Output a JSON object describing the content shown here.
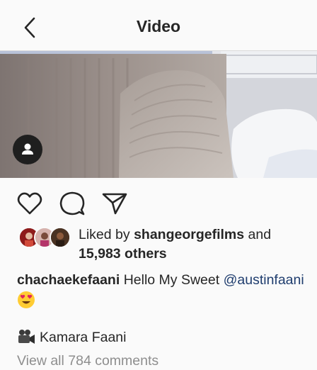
{
  "header": {
    "title": "Video",
    "back_icon": "chevron-left-icon"
  },
  "post": {
    "user_icon": "person-icon",
    "actions": {
      "like_icon": "heart-outline-icon",
      "comment_icon": "comment-icon",
      "share_icon": "paper-plane-icon"
    },
    "likes": {
      "prefix": "Liked by",
      "user": "shangeorgefilms",
      "middle": "and",
      "count": "15,983 others"
    },
    "caption": {
      "username": "chachaekefaani",
      "text": "Hello My Sweet",
      "mention": "@austinfaani",
      "emoji": "heart-eyes-emoji"
    },
    "credit": {
      "icon": "movie-camera-icon",
      "text": "Kamara Faani"
    },
    "view_comments": "View all 784 comments"
  },
  "colors": {
    "background": "#fafafa",
    "text": "#262626",
    "muted": "#8e8e8e",
    "mention": "#1f3d6e"
  }
}
